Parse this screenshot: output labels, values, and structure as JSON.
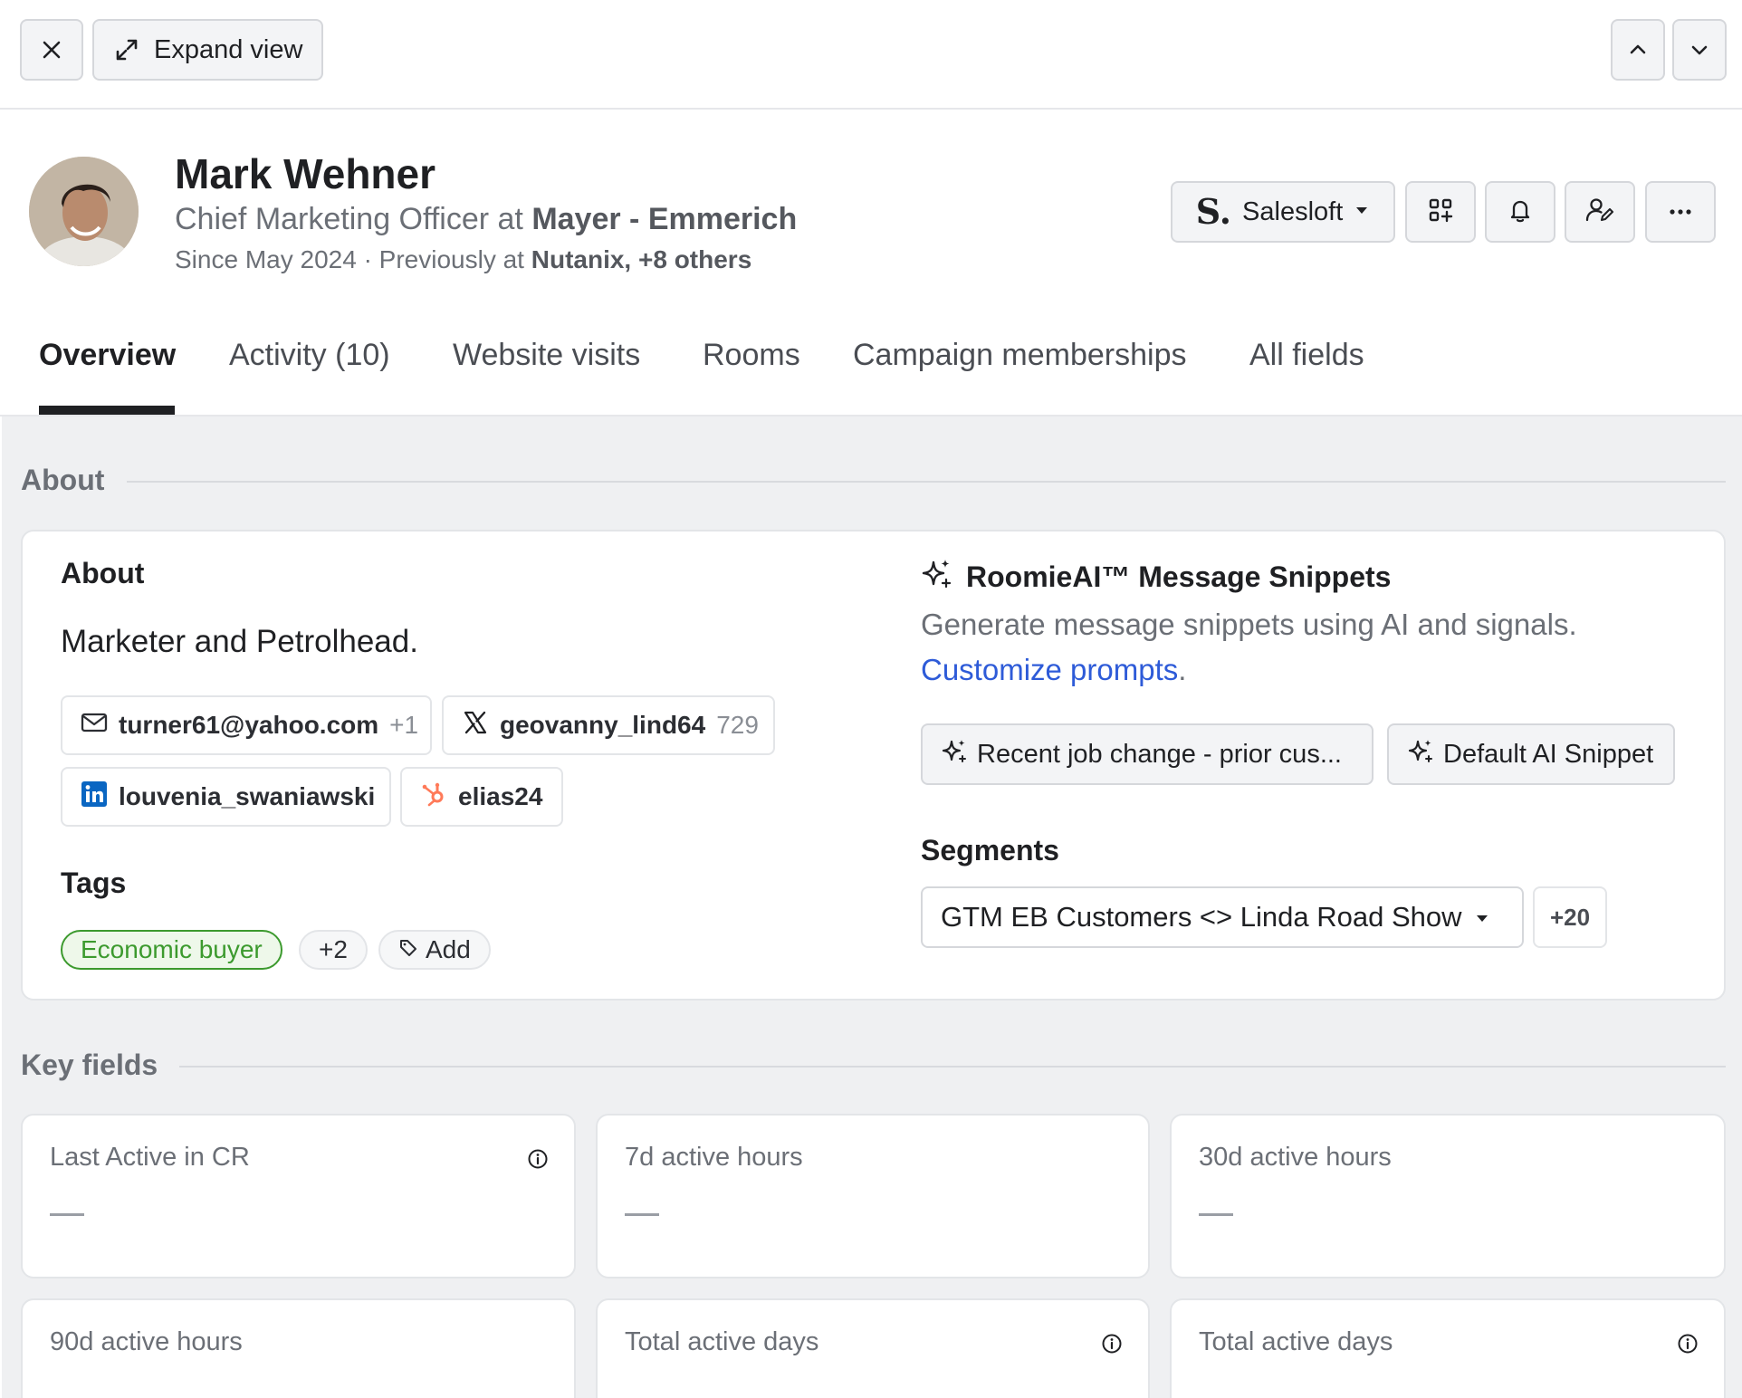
{
  "topbar": {
    "close_icon": "close-icon",
    "expand_label": "Expand view",
    "prev_icon": "chevron-up-icon",
    "next_icon": "chevron-down-icon"
  },
  "person": {
    "name": "Mark Wehner",
    "role": "Chief Marketing Officer",
    "at_word": "at",
    "company": "Mayer - Emmerich",
    "since": "Since May 2024 · Previously at",
    "previous": "Nutanix, +8 others"
  },
  "actions": {
    "crm_label": "Salesloft",
    "crm_logo": "S."
  },
  "tabs": [
    {
      "label": "Overview",
      "active": true
    },
    {
      "label": "Activity (10)"
    },
    {
      "label": "Website visits"
    },
    {
      "label": "Rooms"
    },
    {
      "label": "Campaign memberships"
    },
    {
      "label": "All fields"
    }
  ],
  "about_section": {
    "heading": "About",
    "card_title": "About",
    "bio": "Marketer and Petrolhead.",
    "email": {
      "value": "turner61@yahoo.com",
      "extra": "+1"
    },
    "twitter": {
      "handle": "geovanny_lind64",
      "count": "729"
    },
    "linkedin": {
      "handle": "louvenia_swaniawski"
    },
    "hubspot": {
      "handle": "elias24"
    },
    "tags_title": "Tags",
    "tag": "Economic buyer",
    "tag_more": "+2",
    "tag_add": "Add",
    "ai_title": "RoomieAI™ Message Snippets",
    "ai_desc": "Generate message snippets using AI and signals.",
    "ai_link": "Customize prompts",
    "ai_link_period": ".",
    "snippet_1": "Recent job change - prior cus...",
    "snippet_2": "Default AI Snippet",
    "segments_title": "Segments",
    "segment": "GTM EB Customers <> Linda Road Show",
    "segment_more": "+20"
  },
  "key_fields": {
    "heading": "Key fields",
    "empty_value": "—",
    "items": [
      {
        "label": "Last Active in CR",
        "info": true
      },
      {
        "label": "7d active hours",
        "info": false
      },
      {
        "label": "30d active hours",
        "info": false
      },
      {
        "label": "90d active hours",
        "info": false
      },
      {
        "label": "Total active days",
        "info": true
      },
      {
        "label": "Total active days",
        "info": true
      }
    ]
  },
  "colors": {
    "accent_link": "#2e5bd8",
    "tag_green": "#3c9a2e",
    "tag_green_bg": "#eef8ea",
    "linkedin_blue": "#0a66c2",
    "hubspot_orange": "#ff7a59"
  }
}
